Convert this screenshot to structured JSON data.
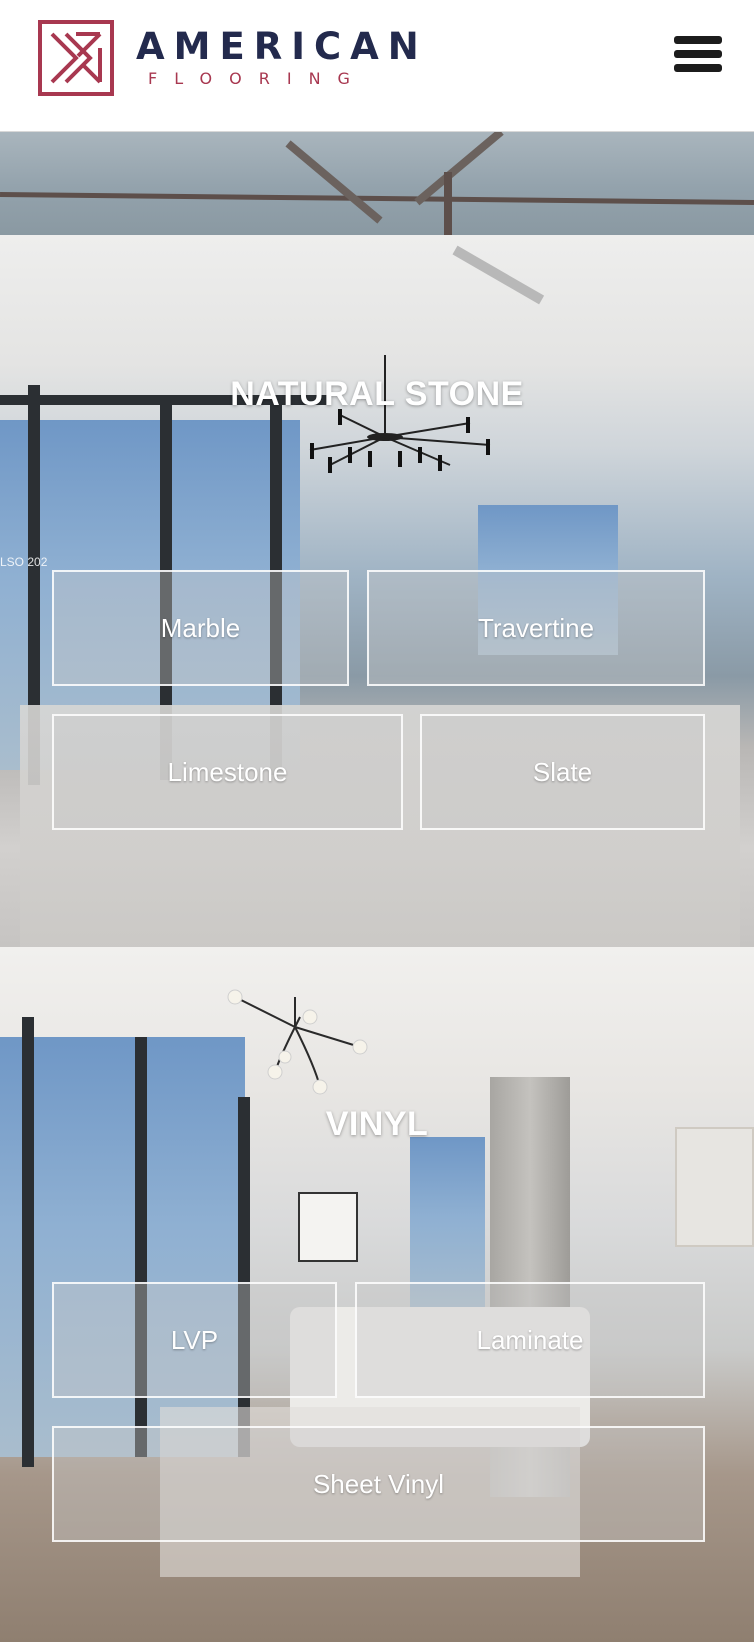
{
  "header": {
    "logo_top": "AMERICAN",
    "logo_bottom": "FLOORING",
    "menu_icon": "hamburger-menu-icon",
    "brand_colors": {
      "navy": "#232a4d",
      "crimson": "#a83850"
    }
  },
  "sections": {
    "natural_stone": {
      "title": "NATURAL STONE",
      "watermark": "LSO 202",
      "buttons": {
        "marble": "Marble",
        "travertine": "Travertine",
        "limestone": "Limestone",
        "slate": "Slate"
      }
    },
    "vinyl": {
      "title": "VINYL",
      "buttons": {
        "lvp": "LVP",
        "laminate": "Laminate",
        "sheet_vinyl": "Sheet Vinyl"
      }
    }
  }
}
